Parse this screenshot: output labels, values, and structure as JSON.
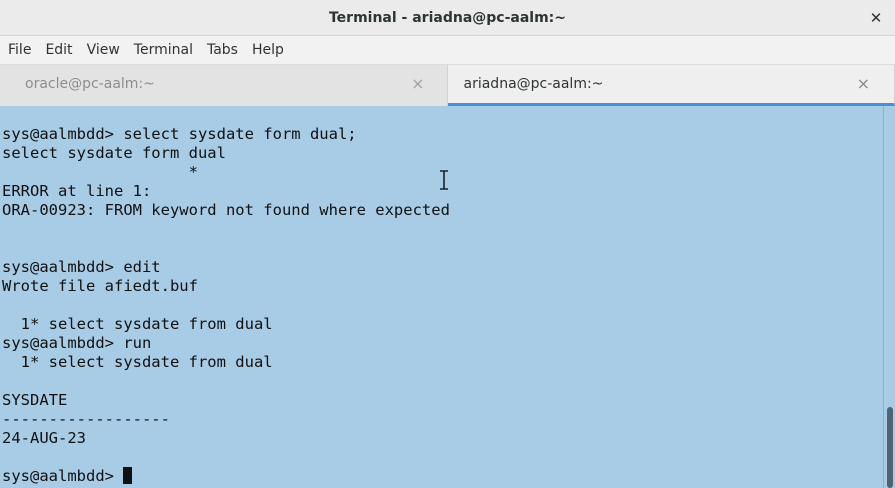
{
  "window": {
    "title": "Terminal - ariadna@pc-aalm:~",
    "close_glyph": "✕"
  },
  "menu": [
    "File",
    "Edit",
    "View",
    "Terminal",
    "Tabs",
    "Help"
  ],
  "tabs": [
    {
      "label": "oracle@pc-aalm:~",
      "active": false,
      "close": "×"
    },
    {
      "label": "ariadna@pc-aalm:~",
      "active": true,
      "close": "×"
    }
  ],
  "terminal": {
    "background": "#a8cbe6",
    "lines": [
      "sys@aalmbdd> select sysdate form dual;",
      "select sysdate form dual",
      "                    *",
      "ERROR at line 1:",
      "ORA-00923: FROM keyword not found where expected",
      "",
      "",
      "sys@aalmbdd> edit",
      "Wrote file afiedt.buf",
      "",
      "  1* select sysdate from dual",
      "sys@aalmbdd> run",
      "  1* select sysdate from dual",
      "",
      "SYSDATE",
      "------------------",
      "24-AUG-23",
      "",
      "sys@aalmbdd> "
    ]
  },
  "icons": {
    "window_close": "close-icon",
    "tab_close": "tab-close-icon",
    "text_cursor": "ibeam-cursor-icon"
  }
}
